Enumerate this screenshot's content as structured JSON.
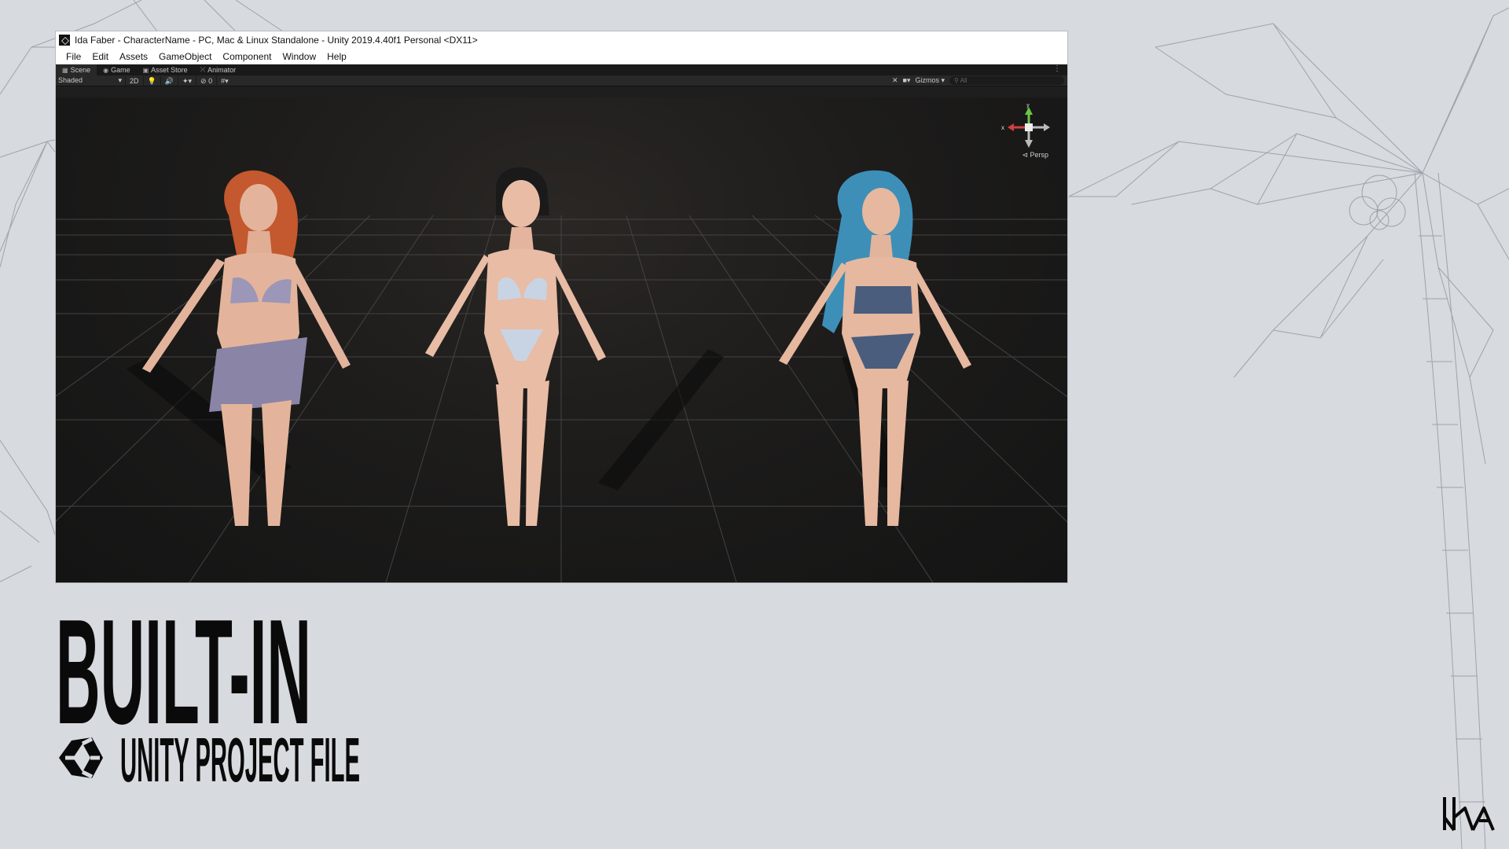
{
  "window": {
    "title": "Ida Faber - CharacterName - PC, Mac & Linux Standalone - Unity 2019.4.40f1 Personal <DX11>"
  },
  "menubar": {
    "items": [
      "File",
      "Edit",
      "Assets",
      "GameObject",
      "Component",
      "Window",
      "Help"
    ]
  },
  "tabs": [
    {
      "label": "Scene",
      "icon": "scene-icon"
    },
    {
      "label": "Game",
      "icon": "game-icon"
    },
    {
      "label": "Asset Store",
      "icon": "store-icon"
    },
    {
      "label": "Animator",
      "icon": "animator-icon"
    }
  ],
  "toolbar": {
    "shading_mode": "Shaded",
    "mode_2d": "2D",
    "hidden_count": "0",
    "gizmos_label": "Gizmos",
    "search_placeholder": "All"
  },
  "gizmo": {
    "y_label": "y",
    "x_label": "x",
    "persp_label": "Persp"
  },
  "headline": {
    "main": "BUILT-IN",
    "sub": "UNITY PROJECT FILE"
  },
  "colors": {
    "page_background": "#d7dade",
    "titlebar_background": "#ffffff",
    "viewport_background": "#1d1c1b",
    "text_dark": "#0a0a0a"
  }
}
